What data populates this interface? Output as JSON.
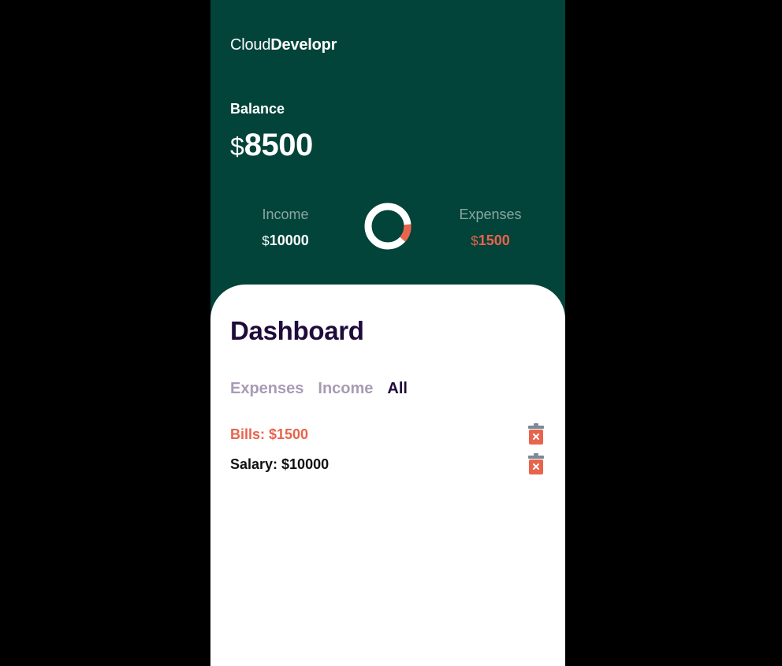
{
  "brand": {
    "light": "Cloud",
    "bold": "Developr"
  },
  "balance": {
    "label": "Balance",
    "currency": "$",
    "amount": "8500"
  },
  "income": {
    "label": "Income",
    "currency": "$",
    "amount": "10000"
  },
  "expenses": {
    "label": "Expenses",
    "currency": "$",
    "amount": "1500"
  },
  "ratio_chart": {
    "income_share": 0.87,
    "expenses_share": 0.13
  },
  "dashboard": {
    "title": "Dashboard",
    "tabs": [
      {
        "label": "Expenses",
        "active": false
      },
      {
        "label": "Income",
        "active": false
      },
      {
        "label": "All",
        "active": true
      }
    ],
    "transactions": [
      {
        "text": "Bills: $1500",
        "type": "expense"
      },
      {
        "text": "Salary: $10000",
        "type": "income"
      }
    ]
  },
  "colors": {
    "header_bg": "#02433a",
    "accent_red": "#e8644c",
    "dark_text": "#1e0b3a",
    "muted_tab": "#a89bb5",
    "trash_lid": "#7a8a96"
  }
}
